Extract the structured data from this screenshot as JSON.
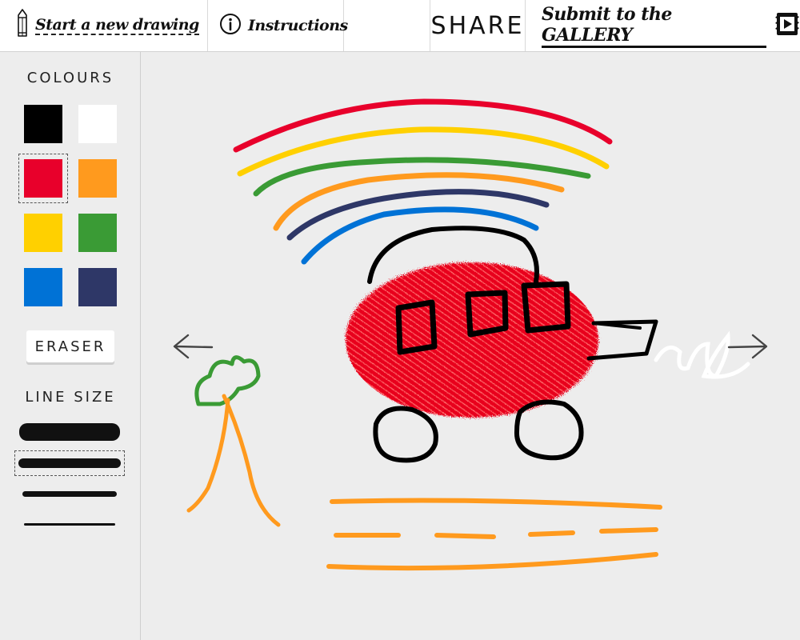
{
  "header": {
    "start_label": "Start a new drawing",
    "instructions_label": "Instructions",
    "share_label": "SHARE",
    "gallery_label": "Submit to the GALLERY"
  },
  "sidebar": {
    "colours_title": "COLOURS",
    "colours": [
      {
        "name": "black",
        "hex": "#000000"
      },
      {
        "name": "white",
        "hex": "#ffffff"
      },
      {
        "name": "red",
        "hex": "#e8002b",
        "selected": true
      },
      {
        "name": "orange",
        "hex": "#ff9a1e"
      },
      {
        "name": "yellow",
        "hex": "#ffd000"
      },
      {
        "name": "green",
        "hex": "#3a9b35"
      },
      {
        "name": "blue",
        "hex": "#0072d6"
      },
      {
        "name": "navy",
        "hex": "#2e3767"
      }
    ],
    "eraser_label": "ERASER",
    "line_size_title": "LINE SIZE",
    "line_sizes": [
      {
        "name": "extra-thick"
      },
      {
        "name": "thick",
        "selected": true
      },
      {
        "name": "medium"
      },
      {
        "name": "thin"
      }
    ]
  },
  "icons": {
    "pencil": "pencil-icon",
    "info": "info-icon",
    "gallery": "play-icon",
    "prev": "arrow-left-icon",
    "next": "arrow-right-icon"
  }
}
